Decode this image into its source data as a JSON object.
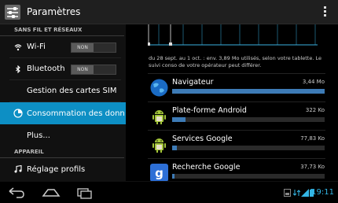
{
  "actionbar": {
    "title": "Paramètres",
    "settings_icon": "settings-app-icon",
    "overflow_icon": "overflow-menu-icon"
  },
  "sidebar": {
    "section1": "SANS FIL ET RÉSEAUX",
    "wifi": {
      "label": "Wi-Fi",
      "toggle": "NON",
      "icon": "wifi-icon"
    },
    "bluetooth": {
      "label": "Bluetooth",
      "toggle": "NON",
      "icon": "bluetooth-icon"
    },
    "sim": {
      "label": "Gestion des cartes SIM"
    },
    "data": {
      "label": "Consommation des donné",
      "icon": "data-usage-icon"
    },
    "more": {
      "label": "Plus..."
    },
    "section2": "APPAREIL",
    "sound": {
      "label": "Réglage profils",
      "icon": "music-note-icon"
    }
  },
  "usage": {
    "info": "du 28 sept. au 1 oct. : env. 3,89 Mo utilisés,  selon votre tablette. Le suivi conso de votre opérateur peut différer.",
    "apps": [
      {
        "name": "Navigateur",
        "size": "3,44 Mo",
        "fraction": 1.0,
        "icon": "browser-globe-icon"
      },
      {
        "name": "Plate-forme Android",
        "size": "322 Ko",
        "fraction": 0.09,
        "icon": "android-robot-icon"
      },
      {
        "name": "Services Google",
        "size": "77,83 Ko",
        "fraction": 0.03,
        "icon": "android-robot-icon"
      },
      {
        "name": "Recherche Google",
        "size": "37,73 Ko",
        "fraction": 0.015,
        "icon": "google-search-icon"
      }
    ]
  },
  "navbar": {
    "back_icon": "back-icon",
    "home_icon": "home-icon",
    "recents_icon": "recent-apps-icon",
    "time": "19:11"
  },
  "colors": {
    "accent": "#0d8fc4",
    "bar": "#3d7bb6",
    "clock": "#33b5e5"
  }
}
